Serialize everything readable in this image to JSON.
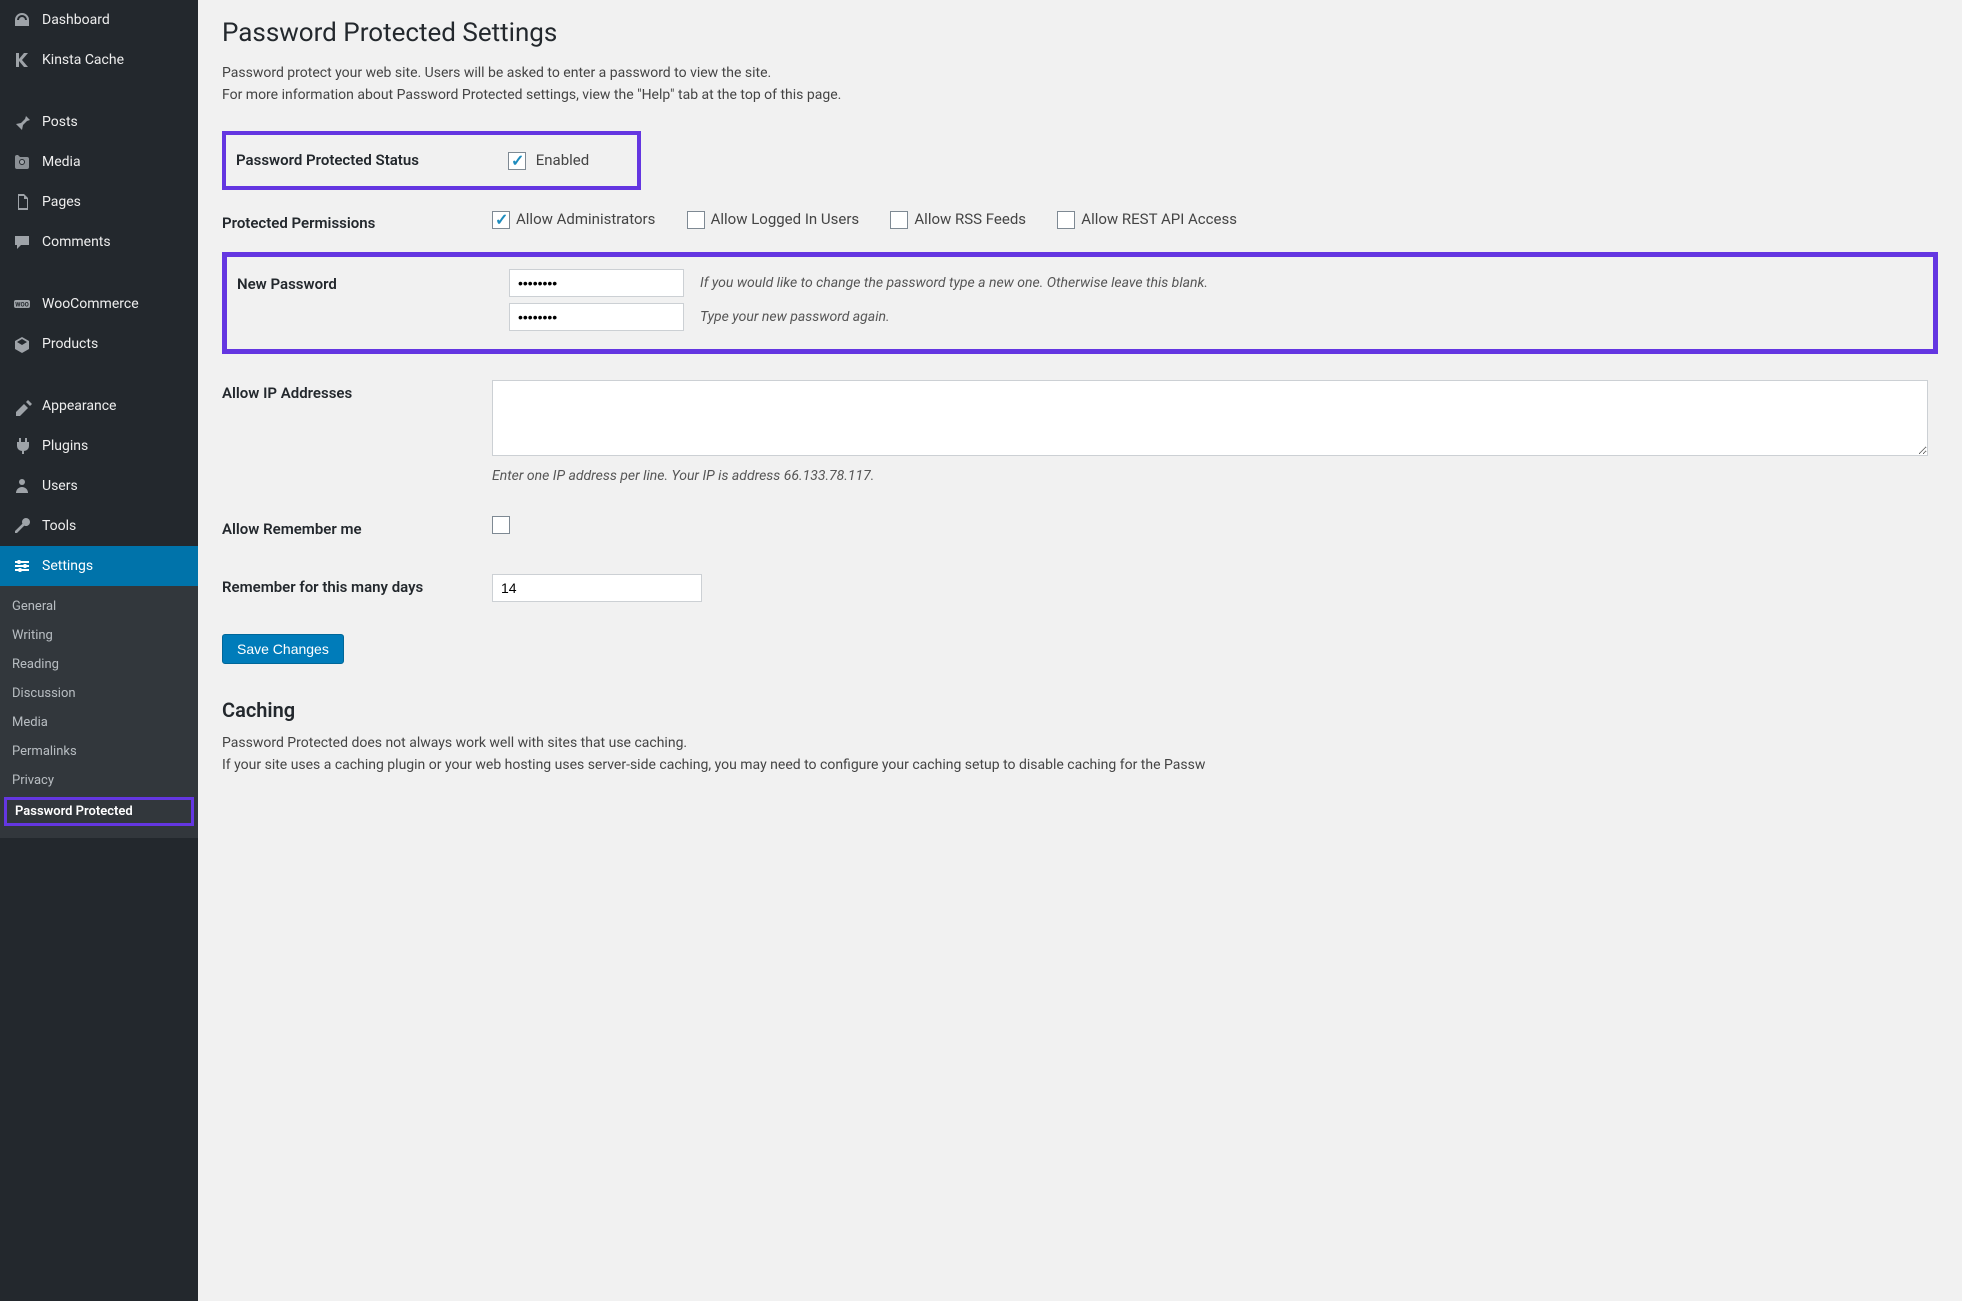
{
  "sidebar": {
    "items": [
      {
        "icon": "dashboard",
        "label": "Dashboard"
      },
      {
        "icon": "k",
        "label": "Kinsta Cache"
      },
      {
        "icon": "pin",
        "label": "Posts"
      },
      {
        "icon": "media",
        "label": "Media"
      },
      {
        "icon": "pages",
        "label": "Pages"
      },
      {
        "icon": "comments",
        "label": "Comments"
      },
      {
        "icon": "woo",
        "label": "WooCommerce"
      },
      {
        "icon": "products",
        "label": "Products"
      },
      {
        "icon": "appearance",
        "label": "Appearance"
      },
      {
        "icon": "plugins",
        "label": "Plugins"
      },
      {
        "icon": "users",
        "label": "Users"
      },
      {
        "icon": "tools",
        "label": "Tools"
      },
      {
        "icon": "settings",
        "label": "Settings",
        "active": true
      }
    ],
    "submenu": [
      "General",
      "Writing",
      "Reading",
      "Discussion",
      "Media",
      "Permalinks",
      "Privacy",
      "Password Protected"
    ],
    "submenu_current": "Password Protected"
  },
  "page": {
    "title": "Password Protected Settings",
    "intro_line1": "Password protect your web site. Users will be asked to enter a password to view the site.",
    "intro_line2": "For more information about Password Protected settings, view the \"Help\" tab at the top of this page."
  },
  "fields": {
    "status_label": "Password Protected Status",
    "enabled_label": "Enabled",
    "permissions_label": "Protected Permissions",
    "perm_admins": "Allow Administrators",
    "perm_logged": "Allow Logged In Users",
    "perm_rss": "Allow RSS Feeds",
    "perm_rest": "Allow REST API Access",
    "newpw_label": "New Password",
    "newpw_desc1": "If you would like to change the password type a new one. Otherwise leave this blank.",
    "newpw_desc2": "Type your new password again.",
    "allowip_label": "Allow IP Addresses",
    "allowip_desc": "Enter one IP address per line. Your IP is address 66.133.78.117.",
    "remember_label": "Allow Remember me",
    "remember_days_label": "Remember for this many days",
    "remember_days_value": "14",
    "submit": "Save Changes"
  },
  "caching": {
    "heading": "Caching",
    "line1": "Password Protected does not always work well with sites that use caching.",
    "line2": "If your site uses a caching plugin or your web hosting uses server-side caching, you may need to configure your caching setup to disable caching for the Passw"
  }
}
